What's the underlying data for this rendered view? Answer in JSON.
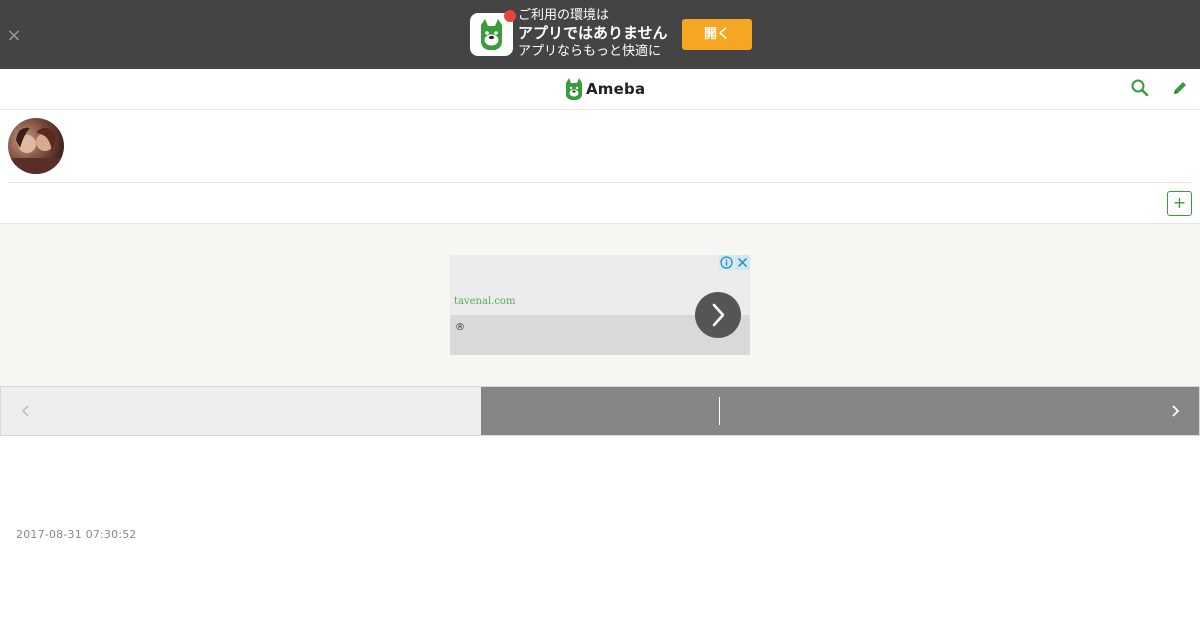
{
  "app_banner": {
    "close_label": "×",
    "line1": "ご利用の環境は",
    "line2": "アプリではありません",
    "line3": "アプリならもっと快適に",
    "open_label": "開く"
  },
  "header": {
    "logo_text": "Ameba",
    "brand_color": "#3a9b3a"
  },
  "profile": {
    "follow_label": "+"
  },
  "ad": {
    "domain": "tavenal.com",
    "registered_mark": "®",
    "info_label": "i",
    "close_label": "✕"
  },
  "pager": {
    "prev_icon": "chevron-left-icon",
    "next_icon": "chevron-right-icon"
  },
  "entry": {
    "date": "2017-08-31 07:30:52"
  }
}
